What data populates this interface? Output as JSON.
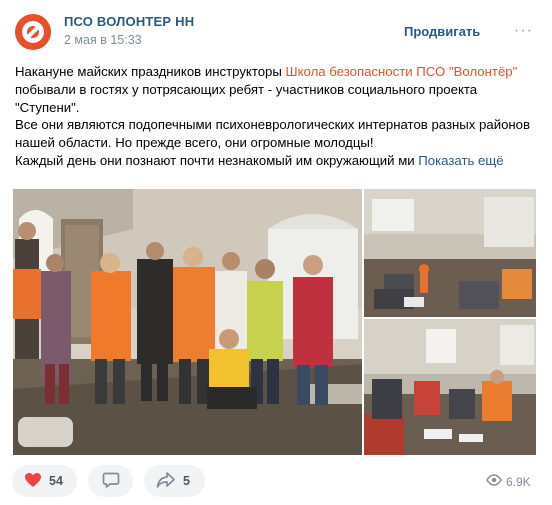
{
  "header": {
    "author": "ПСО ВОЛОНТЕР НН",
    "date": "2 мая в 15:33",
    "promote": "Продвигать",
    "more": "···"
  },
  "text": {
    "line1_a": "Накануне майских праздников инструкторы ",
    "line1_link": "Школа безопасности ПСО \"Волонтёр\"",
    "line1_b": " побывали в гостях у потрясающих ребят - участников социального проекта \"Ступени\".",
    "para2": "Все они являются подопечными психоневрологических интернатов разных районов нашей области. Но прежде всего, они огромные молодцы!",
    "para3": "Каждый день они познают почти незнакомый им окружающий ми",
    "show_more": " Показать ещё"
  },
  "actions": {
    "likes": "54",
    "shares": "5",
    "views": "6.9K"
  },
  "icons": {
    "like": "heart-icon",
    "comment": "comment-icon",
    "share": "share-icon",
    "views": "eye-icon"
  },
  "colors": {
    "accent": "#2a5885",
    "brand": "#e8502a",
    "like": "#e64646",
    "muted": "#818c99"
  }
}
